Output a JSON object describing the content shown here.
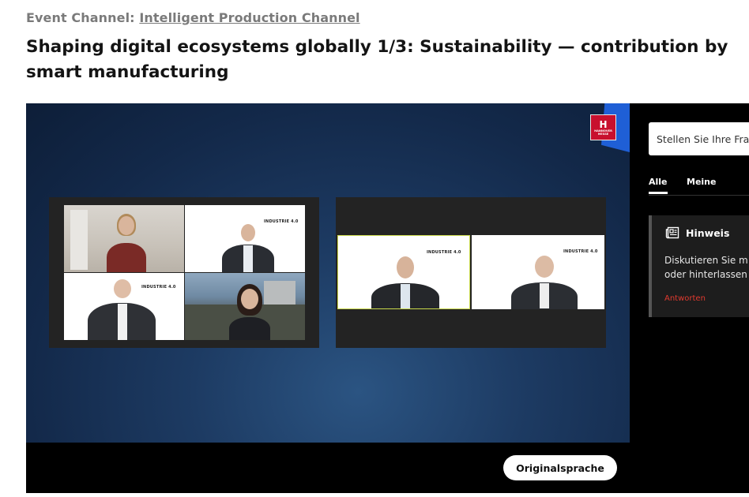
{
  "header": {
    "channel_prefix": "Event Channel:",
    "channel_link": "Intelligent Production Channel",
    "title": "Shaping digital ecosystems globally 1/3: Sustainability — contribution by smart manufacturing"
  },
  "player": {
    "logo_text": "HANNOVER MESSE",
    "badge_text": "INDUSTRIE 4.0",
    "language_button": "Originalsprache"
  },
  "sidebar": {
    "question_placeholder": "Stellen Sie Ihre Frage",
    "tabs": [
      {
        "label": "Alle",
        "active": true
      },
      {
        "label": "Meine",
        "active": false
      }
    ],
    "notice": {
      "title": "Hinweis",
      "text": "Diskutieren Sie m\noder hinterlassen",
      "reply": "Antworten"
    }
  },
  "colors": {
    "accent_red": "#e03a2f",
    "brand_red": "#c8102e",
    "stage_blue": "#1d3b63"
  }
}
